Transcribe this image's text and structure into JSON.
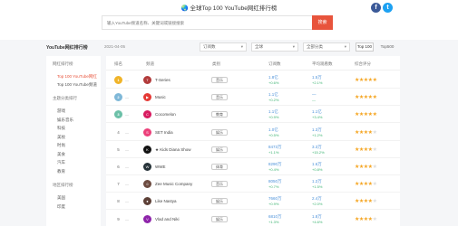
{
  "header": {
    "flag": "🌏",
    "title": "全球Top 100 YouTube网红排行榜",
    "search_placeholder": "输入YouTube频道名称、关键词或链接搜索",
    "search_button": "搜索",
    "share_fb": "f",
    "share_tw": "t"
  },
  "filters": {
    "title": "YouTube网红排行榜",
    "date": "2021-04-05",
    "select1": "订阅数",
    "select2": "全球",
    "select3": "全部分类",
    "caret": "▾",
    "top100": "Top 100",
    "top500": "Top500"
  },
  "sidebar": {
    "sections": [
      {
        "heading": "网红排行榜",
        "items": [
          "Top 100 YouTube网红",
          "Top 100 YouTube频道"
        ],
        "active": 0
      },
      {
        "heading": "主题分类排行",
        "items": [
          "游戏",
          "娱乐音乐",
          "科技",
          "美妆",
          "时尚",
          "美食",
          "汽车",
          "教育"
        ],
        "active": -1
      },
      {
        "heading": "地区排行榜",
        "items": [
          "美国",
          "印度"
        ],
        "active": -1
      }
    ]
  },
  "table": {
    "headers": [
      "排名",
      "频道",
      "类别",
      "订阅数",
      "平均观看数",
      "综合评分"
    ],
    "rows": [
      {
        "rank": "1",
        "medal": "m1",
        "trend": "—",
        "initial": "T",
        "avatar_color": "#b23b3b",
        "name": "T-Series",
        "category": "音乐",
        "subs": "1.8亿",
        "subs_growth": "+0.6%",
        "views": "1.5万",
        "views_growth": "+2.1%",
        "stars": 5
      },
      {
        "rank": "2",
        "medal": "m2",
        "trend": "—",
        "initial": "▶",
        "avatar_color": "#e53935",
        "name": "Music",
        "category": "音乐",
        "subs": "1.1亿",
        "subs_growth": "+0.2%",
        "views": "—",
        "views_growth": "—",
        "stars": 5
      },
      {
        "rank": "3",
        "medal": "m3",
        "trend": "—",
        "initial": "C",
        "avatar_color": "#d81b60",
        "name": "Cocomelon",
        "category": "教育",
        "subs": "1.1亿",
        "subs_growth": "+0.9%",
        "views": "1.1亿",
        "views_growth": "+3.4%",
        "stars": 5
      },
      {
        "rank": "4",
        "medal": "",
        "trend": "—",
        "initial": "S",
        "avatar_color": "#ec407a",
        "name": "SET India",
        "category": "娱乐",
        "subs": "1.0亿",
        "subs_growth": "+0.5%",
        "views": "1.3万",
        "views_growth": "+1.2%",
        "stars": 4
      },
      {
        "rank": "5",
        "medal": "",
        "trend": "—",
        "initial": "K",
        "avatar_color": "#111111",
        "name": "★ Kids Diana Show",
        "category": "娱乐",
        "subs": "8473万",
        "subs_growth": "+1.1%",
        "views": "3.3万",
        "views_growth": "+15.2%",
        "stars": 4
      },
      {
        "rank": "6",
        "medal": "",
        "trend": "—",
        "initial": "W",
        "avatar_color": "#263238",
        "name": "WWE",
        "category": "体育",
        "subs": "8290万",
        "subs_growth": "+0.4%",
        "views": "1.6万",
        "views_growth": "+0.8%",
        "stars": 4
      },
      {
        "rank": "7",
        "medal": "",
        "trend": "—",
        "initial": "☺",
        "avatar_color": "#6d4c41",
        "name": "Zee Music Company",
        "category": "音乐",
        "subs": "8050万",
        "subs_growth": "+0.7%",
        "views": "1.2万",
        "views_growth": "+1.5%",
        "stars": 4
      },
      {
        "rank": "8",
        "medal": "",
        "trend": "—",
        "initial": "●",
        "avatar_color": "#5d4037",
        "name": "Like Nastya",
        "category": "娱乐",
        "subs": "7660万",
        "subs_growth": "+0.9%",
        "views": "2.4万",
        "views_growth": "+2.0%",
        "stars": 4
      },
      {
        "rank": "9",
        "medal": "",
        "trend": "—",
        "initial": "V",
        "avatar_color": "#8e24aa",
        "name": "Vlad and Niki",
        "category": "娱乐",
        "subs": "6810万",
        "subs_growth": "+1.3%",
        "views": "1.8万",
        "views_growth": "+4.6%",
        "stars": 4
      }
    ]
  }
}
